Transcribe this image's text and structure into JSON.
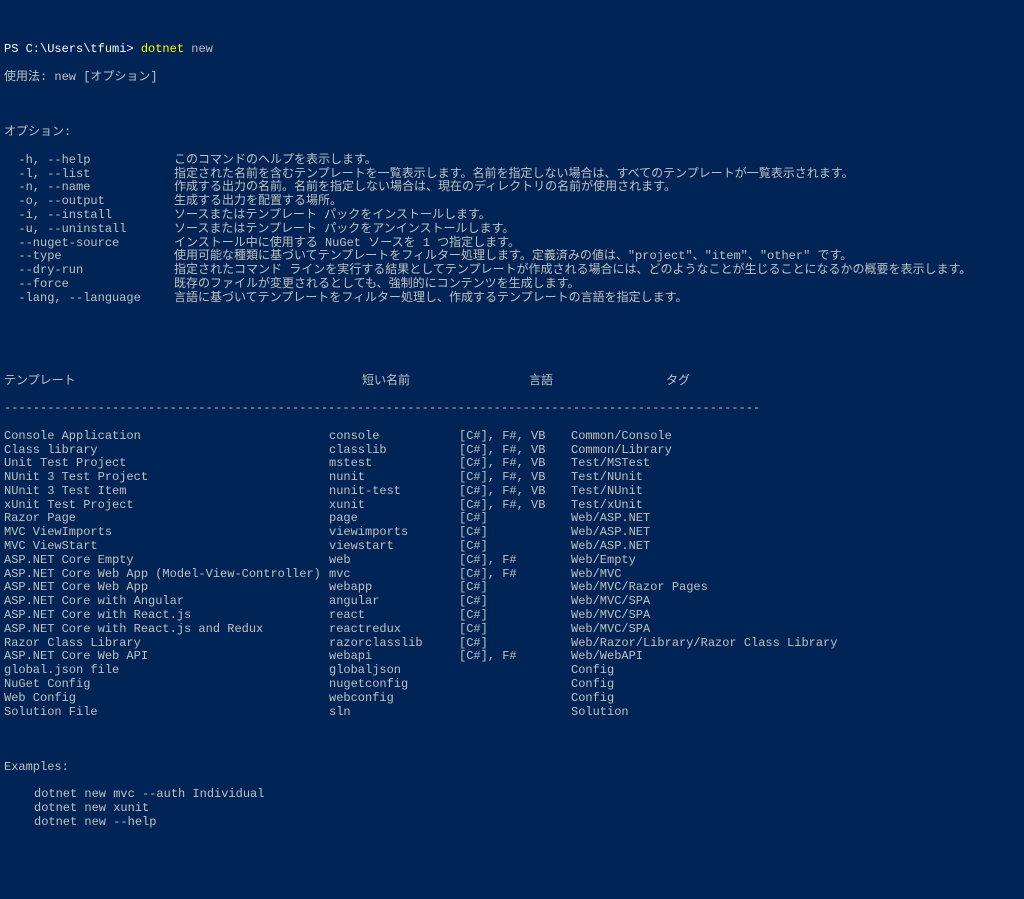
{
  "prompt": {
    "prefix": "PS C:\\Users\\tfumi>",
    "command": "dotnet",
    "arg": "new"
  },
  "usage": "使用法: new [オプション]",
  "options_label": "オプション:",
  "options": [
    {
      "flag": "  -h, --help",
      "desc": "このコマンドのヘルプを表示します。"
    },
    {
      "flag": "  -l, --list",
      "desc": "指定された名前を含むテンプレートを一覧表示します。名前を指定しない場合は、すべてのテンプレートが一覧表示されます。"
    },
    {
      "flag": "  -n, --name",
      "desc": "作成する出力の名前。名前を指定しない場合は、現在のディレクトリの名前が使用されます。"
    },
    {
      "flag": "  -o, --output",
      "desc": "生成する出力を配置する場所。"
    },
    {
      "flag": "  -i, --install",
      "desc": "ソースまたはテンプレート パックをインストールします。"
    },
    {
      "flag": "  -u, --uninstall",
      "desc": "ソースまたはテンプレート パックをアンインストールします。"
    },
    {
      "flag": "  --nuget-source",
      "desc": "インストール中に使用する NuGet ソースを 1 つ指定します。"
    },
    {
      "flag": "  --type",
      "desc": "使用可能な種類に基づいてテンプレートをフィルター処理します。定義済みの値は、\"project\"、\"item\"、\"other\" です。"
    },
    {
      "flag": "  --dry-run",
      "desc": "指定されたコマンド ラインを実行する結果としてテンプレートが作成される場合には、どのようなことが生じることになるかの概要を表示します。"
    },
    {
      "flag": "  --force",
      "desc": "既存のファイルが変更されるとしても、強制的にコンテンツを生成します。"
    },
    {
      "flag": "  -lang, --language",
      "desc": "言語に基づいてテンプレートをフィルター処理し、作成するテンプレートの言語を指定します。"
    }
  ],
  "table_header": {
    "c1": "テンプレート",
    "c2": "短い名前",
    "c3": "言語",
    "c4": "タグ"
  },
  "sep": "---------------------------------------------------------------------------------------------------------",
  "templates": [
    {
      "name": "Console Application",
      "short": "console",
      "lang": "[C#], F#, VB",
      "tags": "Common/Console"
    },
    {
      "name": "Class library",
      "short": "classlib",
      "lang": "[C#], F#, VB",
      "tags": "Common/Library"
    },
    {
      "name": "Unit Test Project",
      "short": "mstest",
      "lang": "[C#], F#, VB",
      "tags": "Test/MSTest"
    },
    {
      "name": "NUnit 3 Test Project",
      "short": "nunit",
      "lang": "[C#], F#, VB",
      "tags": "Test/NUnit"
    },
    {
      "name": "NUnit 3 Test Item",
      "short": "nunit-test",
      "lang": "[C#], F#, VB",
      "tags": "Test/NUnit"
    },
    {
      "name": "xUnit Test Project",
      "short": "xunit",
      "lang": "[C#], F#, VB",
      "tags": "Test/xUnit"
    },
    {
      "name": "Razor Page",
      "short": "page",
      "lang": "[C#]",
      "tags": "Web/ASP.NET"
    },
    {
      "name": "MVC ViewImports",
      "short": "viewimports",
      "lang": "[C#]",
      "tags": "Web/ASP.NET"
    },
    {
      "name": "MVC ViewStart",
      "short": "viewstart",
      "lang": "[C#]",
      "tags": "Web/ASP.NET"
    },
    {
      "name": "ASP.NET Core Empty",
      "short": "web",
      "lang": "[C#], F#",
      "tags": "Web/Empty"
    },
    {
      "name": "ASP.NET Core Web App (Model-View-Controller)",
      "short": "mvc",
      "lang": "[C#], F#",
      "tags": "Web/MVC"
    },
    {
      "name": "ASP.NET Core Web App",
      "short": "webapp",
      "lang": "[C#]",
      "tags": "Web/MVC/Razor Pages"
    },
    {
      "name": "ASP.NET Core with Angular",
      "short": "angular",
      "lang": "[C#]",
      "tags": "Web/MVC/SPA"
    },
    {
      "name": "ASP.NET Core with React.js",
      "short": "react",
      "lang": "[C#]",
      "tags": "Web/MVC/SPA"
    },
    {
      "name": "ASP.NET Core with React.js and Redux",
      "short": "reactredux",
      "lang": "[C#]",
      "tags": "Web/MVC/SPA"
    },
    {
      "name": "Razor Class Library",
      "short": "razorclasslib",
      "lang": "[C#]",
      "tags": "Web/Razor/Library/Razor Class Library"
    },
    {
      "name": "ASP.NET Core Web API",
      "short": "webapi",
      "lang": "[C#], F#",
      "tags": "Web/WebAPI"
    },
    {
      "name": "global.json file",
      "short": "globaljson",
      "lang": "",
      "tags": "Config"
    },
    {
      "name": "NuGet Config",
      "short": "nugetconfig",
      "lang": "",
      "tags": "Config"
    },
    {
      "name": "Web Config",
      "short": "webconfig",
      "lang": "",
      "tags": "Config"
    },
    {
      "name": "Solution File",
      "short": "sln",
      "lang": "",
      "tags": "Solution"
    }
  ],
  "examples_label": "Examples:",
  "examples": [
    "dotnet new mvc --auth Individual",
    "dotnet new xunit",
    "dotnet new --help"
  ]
}
